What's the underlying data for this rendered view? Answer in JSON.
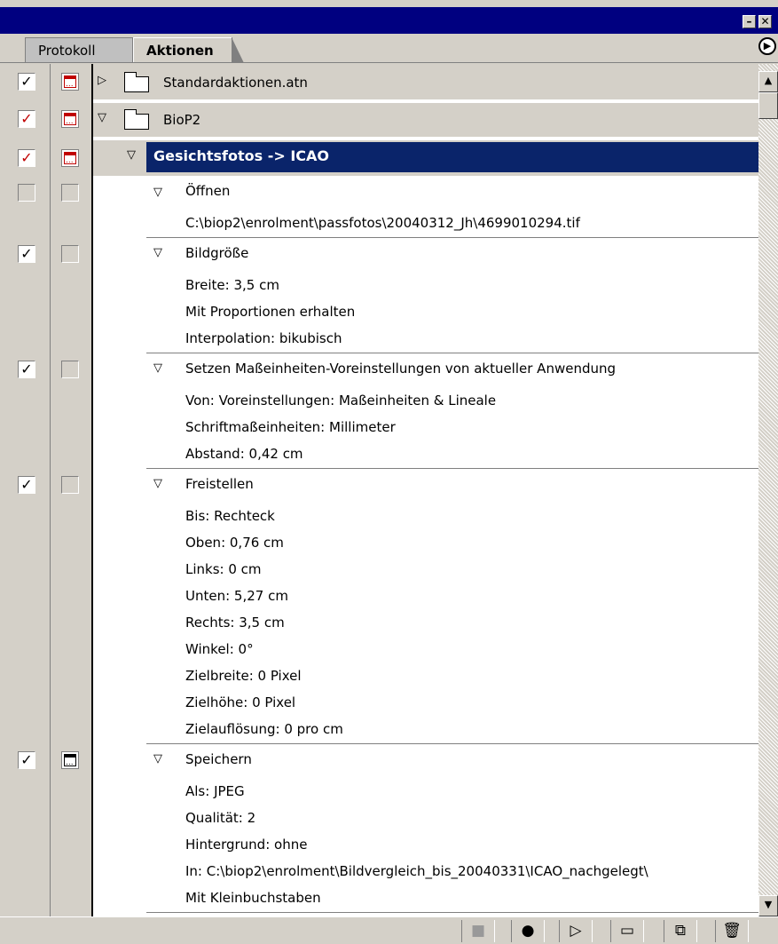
{
  "tabs": [
    {
      "label": "Protokoll",
      "active": false
    },
    {
      "label": "Aktionen",
      "active": true
    }
  ],
  "colors": {
    "selection": "#0a246a",
    "check_red": "#c00000",
    "panel": "#d4d0c8",
    "title": "#000080"
  },
  "rows": {
    "r0": {
      "label": "Standardaktionen.atn",
      "check": "checked",
      "dialog": "red"
    },
    "r1": {
      "label": "BioP2",
      "check": "red",
      "dialog": "red"
    },
    "r2": {
      "label": "Gesichtsfotos -> ICAO",
      "check": "red",
      "dialog": "red",
      "selected": true
    },
    "r3": {
      "label": "Öffnen",
      "params": [
        "C:\\biop2\\enrolment\\passfotos\\20040312_Jh\\4699010294.tif"
      ]
    },
    "r4": {
      "label": "Bildgröße",
      "params": [
        "Breite: 3,5 cm",
        "Mit Proportionen erhalten",
        "Interpolation: bikubisch"
      ]
    },
    "r5": {
      "label": "Setzen Maßeinheiten-Voreinstellungen von aktueller Anwendung",
      "params": [
        "Von: Voreinstellungen: Maßeinheiten & Lineale",
        "Schriftmaßeinheiten: Millimeter",
        "Abstand: 0,42 cm"
      ]
    },
    "r6": {
      "label": "Freistellen",
      "params": [
        "Bis: Rechteck",
        "Oben: 0,76 cm",
        "Links: 0 cm",
        "Unten: 5,27 cm",
        "Rechts: 3,5 cm",
        "Winkel: 0°",
        "Zielbreite: 0 Pixel",
        "Zielhöhe: 0 Pixel",
        "Zielauflösung: 0 pro cm"
      ]
    },
    "r7": {
      "label": "Speichern",
      "params": [
        "Als: JPEG",
        "Qualität: 2",
        "Hintergrund: ohne",
        "In: C:\\biop2\\enrolment\\Bildvergleich_bis_20040331\\ICAO_nachgelegt\\",
        "Mit Kleinbuchstaben"
      ]
    }
  },
  "icons": {
    "expand": "triangle-right-icon",
    "collapse": "triangle-down-icon",
    "folder": "folder-icon",
    "check": "checkmark-icon",
    "dialog": "dialog-toggle-icon"
  },
  "toolbar": [
    "stop-icon",
    "record-icon",
    "play-icon",
    "new-set-icon",
    "new-action-icon",
    "delete-icon"
  ]
}
